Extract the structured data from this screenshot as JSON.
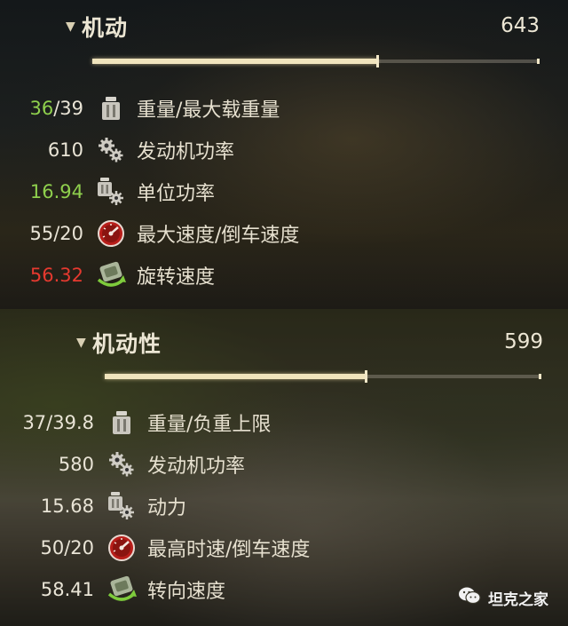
{
  "top": {
    "title": "机动",
    "total": "643",
    "fill_fraction": 0.64,
    "rows": [
      {
        "current": "36",
        "rest": "/39",
        "current_color": "green",
        "icon": "weight-icon",
        "label": "重量/最大载重量"
      },
      {
        "current": "610",
        "rest": "",
        "current_color": "normal",
        "icon": "engine-gears-icon",
        "label": "发动机功率"
      },
      {
        "current": "16.94",
        "rest": "",
        "current_color": "green",
        "icon": "specific-power-icon",
        "label": "单位功率"
      },
      {
        "current": "55/20",
        "rest": "",
        "current_color": "normal",
        "icon": "speedometer-icon",
        "label": "最大速度/倒车速度"
      },
      {
        "current": "56.32",
        "rest": "",
        "current_color": "red",
        "icon": "traverse-icon",
        "label": "旋转速度"
      }
    ]
  },
  "bottom": {
    "title": "机动性",
    "total": "599",
    "fill_fraction": 0.6,
    "rows": [
      {
        "current": "37/39.8",
        "rest": "",
        "current_color": "normal",
        "icon": "weight-icon",
        "label": "重量/负重上限"
      },
      {
        "current": "580",
        "rest": "",
        "current_color": "normal",
        "icon": "engine-gears-icon",
        "label": "发动机功率"
      },
      {
        "current": "15.68",
        "rest": "",
        "current_color": "normal",
        "icon": "specific-power-icon",
        "label": "动力"
      },
      {
        "current": "50/20",
        "rest": "",
        "current_color": "normal",
        "icon": "speedometer-icon",
        "label": "最高时速/倒车速度"
      },
      {
        "current": "58.41",
        "rest": "",
        "current_color": "normal",
        "icon": "traverse-icon",
        "label": "转向速度"
      }
    ]
  },
  "watermark": {
    "text": "坦克之家",
    "icon": "wechat-icon"
  },
  "colors": {
    "green": "#8fd04d",
    "red": "#e5392f",
    "bar_fill": "#f0e4bd"
  }
}
